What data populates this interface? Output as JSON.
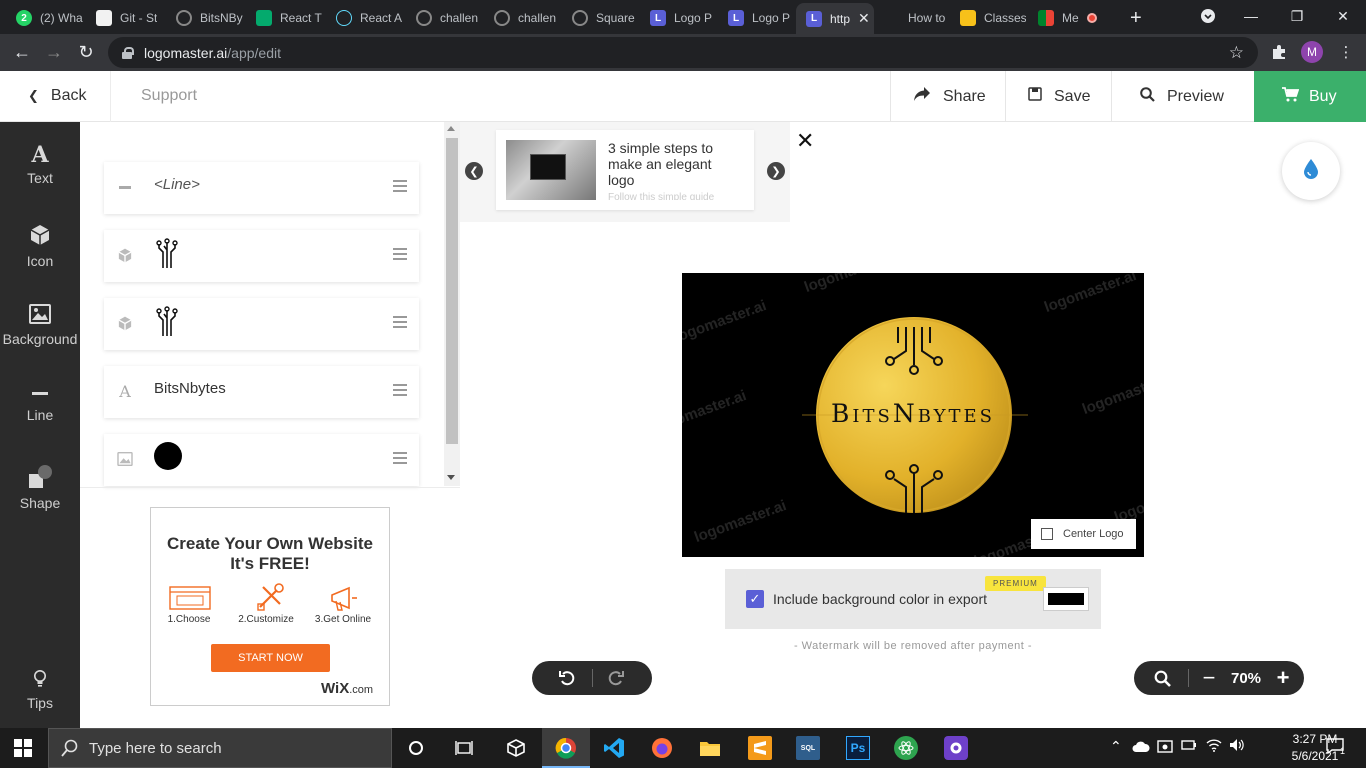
{
  "browser": {
    "tabs": [
      {
        "label": "(2) Wha",
        "favicon": "whatsapp-icon",
        "color": "#25d366"
      },
      {
        "label": "Git - St",
        "favicon": "git-icon",
        "color": "#f1f1f1"
      },
      {
        "label": "BitsNBy",
        "favicon": "globe-icon",
        "color": "#888"
      },
      {
        "label": "React T",
        "favicon": "w3-icon",
        "color": "#04aa6d"
      },
      {
        "label": "React A",
        "favicon": "react-icon",
        "color": "#61dafb"
      },
      {
        "label": "challen",
        "favicon": "globe-icon",
        "color": "#888"
      },
      {
        "label": "challen",
        "favicon": "globe-icon",
        "color": "#888"
      },
      {
        "label": "Square",
        "favicon": "globe-icon",
        "color": "#888"
      },
      {
        "label": "Logo P",
        "favicon": "logomaster-icon",
        "color": "#5a5fd6"
      },
      {
        "label": "Logo P",
        "favicon": "logomaster-icon",
        "color": "#5a5fd6"
      },
      {
        "label": "http",
        "favicon": "logomaster-icon",
        "color": "#5a5fd6",
        "active": true
      },
      {
        "label": "How to",
        "favicon": "blank-icon",
        "color": "#202124"
      },
      {
        "label": "Classes",
        "favicon": "classroom-icon",
        "color": "#f7c11a"
      },
      {
        "label": "Me",
        "favicon": "meet-icon",
        "color": "#00897b"
      }
    ],
    "url_host": "logomaster.ai",
    "url_path": "/app/edit",
    "profile_initial": "M"
  },
  "header": {
    "back_label": "Back",
    "support_label": "Support",
    "share_label": "Share",
    "save_label": "Save",
    "preview_label": "Preview",
    "buy_label": "Buy"
  },
  "toolbar": {
    "items": [
      {
        "label": "Text",
        "icon": "text-icon"
      },
      {
        "label": "Icon",
        "icon": "cube-icon"
      },
      {
        "label": "Background",
        "icon": "image-icon"
      },
      {
        "label": "Line",
        "icon": "line-icon"
      },
      {
        "label": "Shape",
        "icon": "shape-icon"
      }
    ],
    "tips_label": "Tips"
  },
  "layers": {
    "items": [
      {
        "type": "line-icon",
        "content": "<Line>"
      },
      {
        "type": "cube-icon",
        "content": "circuit-icon"
      },
      {
        "type": "cube-icon",
        "content": "circuit-icon"
      },
      {
        "type": "text-icon",
        "content": "BitsNbytes"
      },
      {
        "type": "image-icon",
        "content": "black-circle"
      }
    ]
  },
  "ad": {
    "title_line1": "Create Your Own Website",
    "title_line2": "It's FREE!",
    "step1": "1.Choose",
    "step2": "2.Customize",
    "step3": "3.Get Online",
    "button": "START NOW",
    "brand": "WiX",
    "brand_suffix": ".com"
  },
  "promo": {
    "text": "3 simple steps to make an elegant logo",
    "subtext": "Follow this simple guide"
  },
  "canvas": {
    "logo_text": "BitsNbytes",
    "watermark": "logomaster.ai",
    "center_logo_label": "Center Logo",
    "background_color": "#000000",
    "circle_color": "#e8b92e"
  },
  "export": {
    "checked": true,
    "label": "Include background color in export",
    "premium_badge": "PREMIUM",
    "swatch_color": "#000000",
    "watermark_note": "- Watermark will be removed after payment -"
  },
  "zoom": {
    "level": "70%"
  },
  "taskbar": {
    "search_placeholder": "Type here to search",
    "time": "3:27 PM",
    "date": "5/6/2021",
    "notification_count": "1"
  },
  "colors": {
    "accent": "#5a5fd6",
    "buy_green": "#3bb06b",
    "sidebar_dark": "#2b2b2b"
  }
}
